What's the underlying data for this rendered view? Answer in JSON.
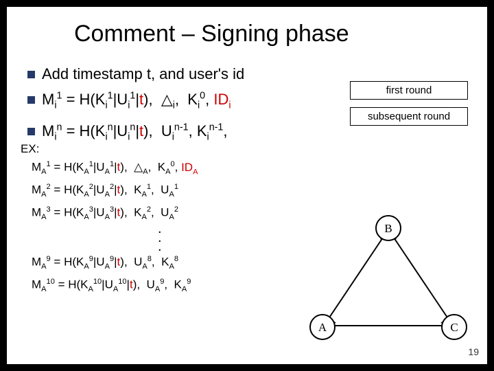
{
  "title": "Comment – Signing phase",
  "bullets": {
    "b1": "Add timestamp t, and user's id",
    "b2_lhs": "M",
    "b2_eq": " = H(K",
    "b2_mid1": "|U",
    "b2_mid2": "|",
    "b2_t": "t",
    "b2_close": "),  ",
    "b2_tri": "△",
    "b2_k0": ",  K",
    "b2_id": ", ID",
    "b3_u": ",  U",
    "b3_k": ", K"
  },
  "labels": {
    "first": "first round",
    "subsequent": "subsequent round"
  },
  "ex": {
    "hdr": "EX:",
    "lines": [
      {
        "n": "1",
        "tail_kind": "tri-id",
        "tri": "△",
        "k_idx": "0"
      },
      {
        "n": "2",
        "tail_kind": "ku",
        "k_idx": "1",
        "u_idx": "1"
      },
      {
        "n": "3",
        "tail_kind": "ku",
        "k_idx": "2",
        "u_idx": "2"
      }
    ],
    "later": [
      {
        "n": "9",
        "u_idx": "8",
        "k_idx": "8"
      },
      {
        "n": "10",
        "u_idx": "9",
        "k_idx": "9"
      }
    ]
  },
  "graph": {
    "A": "A",
    "B": "B",
    "C": "C"
  },
  "slide_number": "19"
}
